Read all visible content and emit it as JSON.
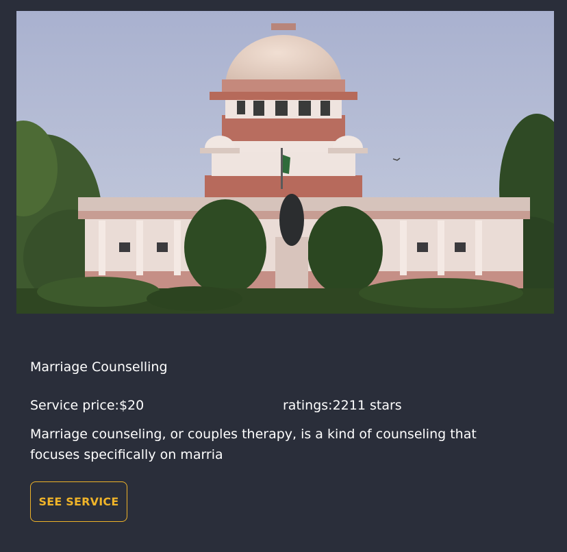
{
  "service": {
    "image_alt": "Supreme Court building",
    "title": "Marriage Counselling",
    "price_text": "Service price:$20",
    "ratings_text": "ratings:2211 stars",
    "description": "Marriage counseling, or couples therapy, is a kind of counseling that focuses specifically on marria",
    "button_label": "SEE SERVICE"
  },
  "colors": {
    "background": "#2a2e3a",
    "accent": "#f0b429",
    "text": "#ffffff"
  }
}
